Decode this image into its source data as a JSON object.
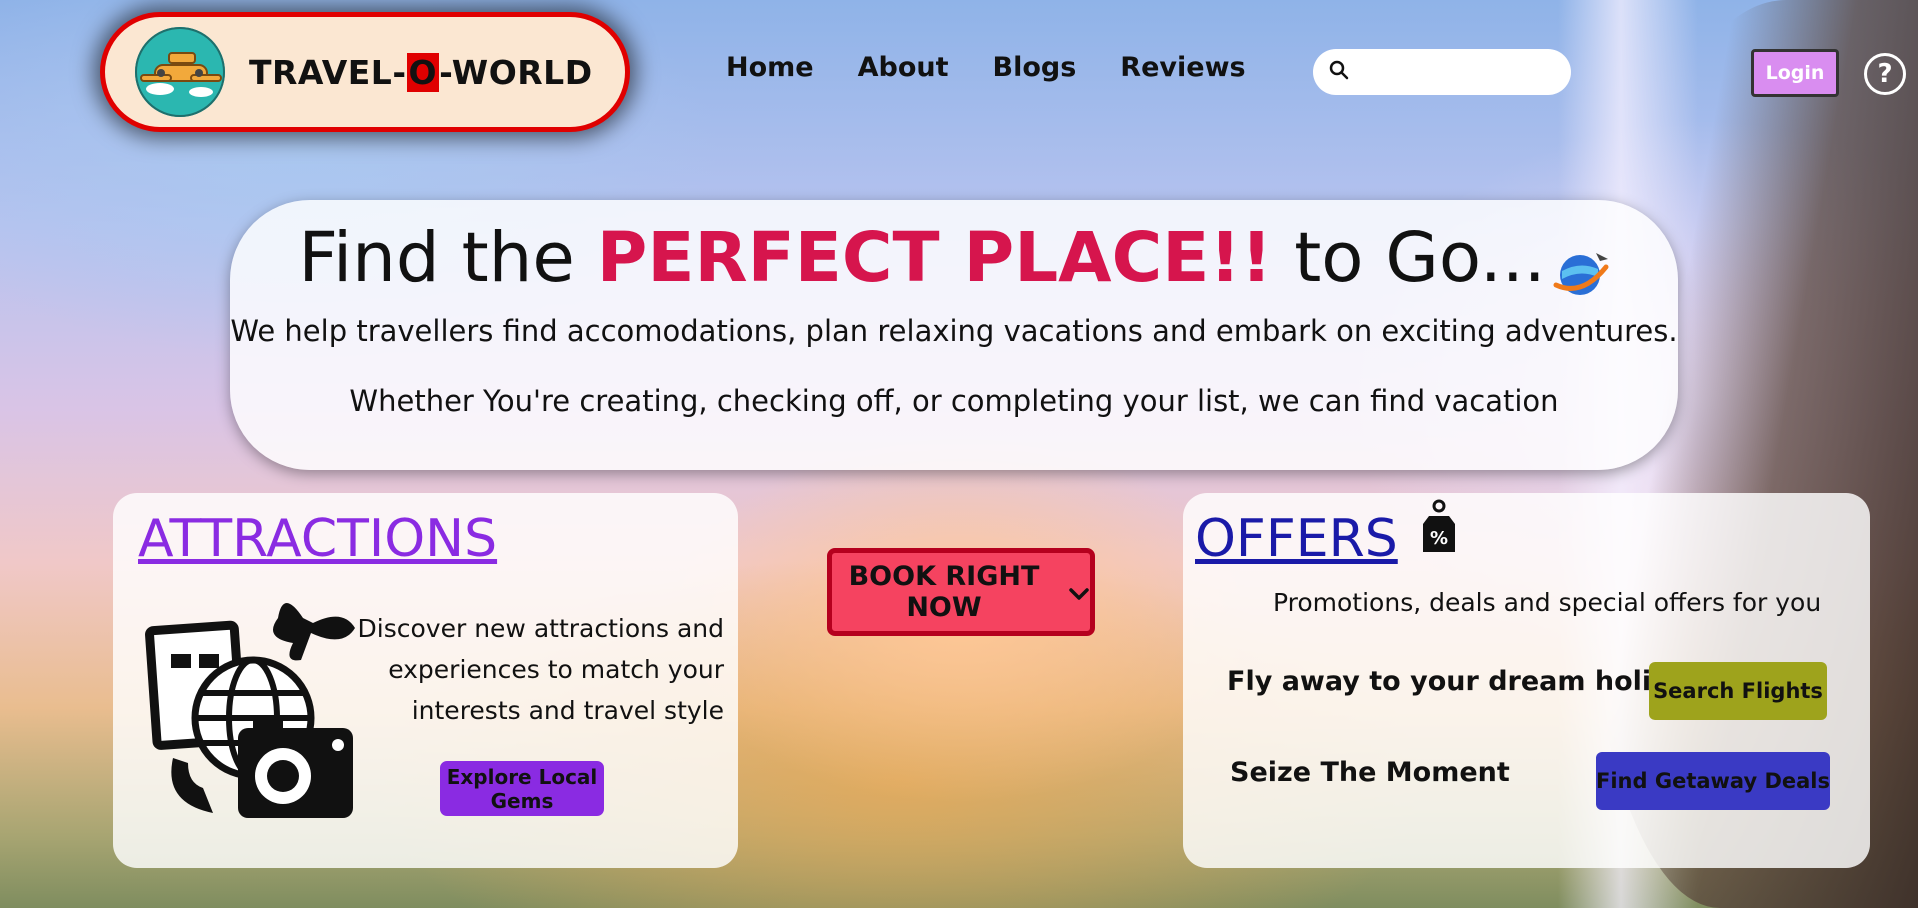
{
  "header": {
    "brand_prefix": "TRAVEL-",
    "brand_o": "O",
    "brand_suffix": "-WORLD",
    "logo_icon": "airplane-globe-icon",
    "nav": [
      "Home",
      "About",
      "Blogs",
      "Reviews"
    ],
    "search_placeholder": "",
    "search_icon": "search-icon",
    "login_label": "Login",
    "help_label": "?"
  },
  "hero": {
    "title_before": "Find the ",
    "title_highlight": "PERFECT PLACE!!",
    "title_after": " to Go...",
    "title_icon": "globe-plane-icon",
    "line1": "We help travellers find accomodations, plan relaxing vacations and embark on exciting adventures.",
    "line2": "Whether You're creating, checking off, or completing your list, we can find vacation"
  },
  "attractions": {
    "title": "ATTRACTIONS",
    "description": "Discover new attractions and experiences to match your interests and travel style",
    "button_label": "Explore Local Gems",
    "icon": "travel-collage-icon"
  },
  "book": {
    "label": "BOOK RIGHT NOW",
    "icon": "chevron-down-icon"
  },
  "offers": {
    "title": "OFFERS",
    "icon": "discount-tag-icon",
    "subtitle": "Promotions, deals and special offers for you",
    "fly_text": "Fly away to your dream holiday",
    "flights_button": "Search Flights",
    "seize_text": "Seize The Moment",
    "getaway_button": "Find Getaway Deals"
  },
  "colors": {
    "brand_border": "#e00000",
    "highlight": "#d6154d",
    "attractions_title": "#8a2be2",
    "offers_title": "#1a1aa8",
    "book_button": "#f54360",
    "flights_button": "#9ea31c",
    "getaway_button": "#3a3ac4",
    "login_button": "#d98df0"
  }
}
